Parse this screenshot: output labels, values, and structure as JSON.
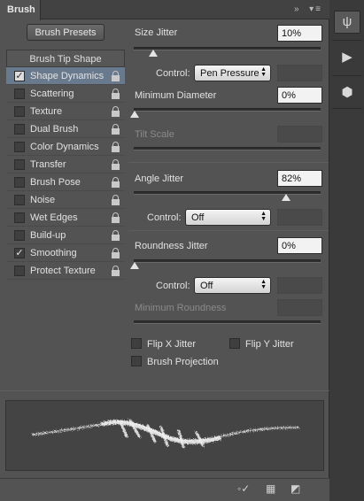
{
  "tab": {
    "title": "Brush"
  },
  "presets_button": "Brush Presets",
  "tip_shape": "Brush Tip Shape",
  "options": [
    {
      "label": "Shape Dynamics",
      "checked": true,
      "selected": true
    },
    {
      "label": "Scattering",
      "checked": false
    },
    {
      "label": "Texture",
      "checked": false
    },
    {
      "label": "Dual Brush",
      "checked": false
    },
    {
      "label": "Color Dynamics",
      "checked": false
    },
    {
      "label": "Transfer",
      "checked": false
    },
    {
      "label": "Brush Pose",
      "checked": false
    },
    {
      "label": "Noise",
      "checked": false
    },
    {
      "label": "Wet Edges",
      "checked": false
    },
    {
      "label": "Build-up",
      "checked": false
    },
    {
      "label": "Smoothing",
      "checked": true
    },
    {
      "label": "Protect Texture",
      "checked": false
    }
  ],
  "settings": {
    "size_jitter": {
      "label": "Size Jitter",
      "value": "10%",
      "level": 0.1
    },
    "control1": {
      "label": "Control:",
      "value": "Pen Pressure"
    },
    "min_diameter": {
      "label": "Minimum Diameter",
      "value": "0%",
      "level": 0.0
    },
    "tilt_scale": {
      "label": "Tilt Scale"
    },
    "angle_jitter": {
      "label": "Angle Jitter",
      "value": "82%",
      "level": 0.82
    },
    "control2": {
      "label": "Control:",
      "value": "Off"
    },
    "roundness_jitter": {
      "label": "Roundness Jitter",
      "value": "0%",
      "level": 0.0
    },
    "control3": {
      "label": "Control:",
      "value": "Off"
    },
    "min_roundness": {
      "label": "Minimum Roundness"
    },
    "flip_x": {
      "label": "Flip X Jitter",
      "checked": false
    },
    "flip_y": {
      "label": "Flip Y Jitter",
      "checked": false
    },
    "projection": {
      "label": "Brush Projection",
      "checked": false
    }
  },
  "icons": {
    "check": "✓",
    "select_arrows": "▲▼"
  }
}
